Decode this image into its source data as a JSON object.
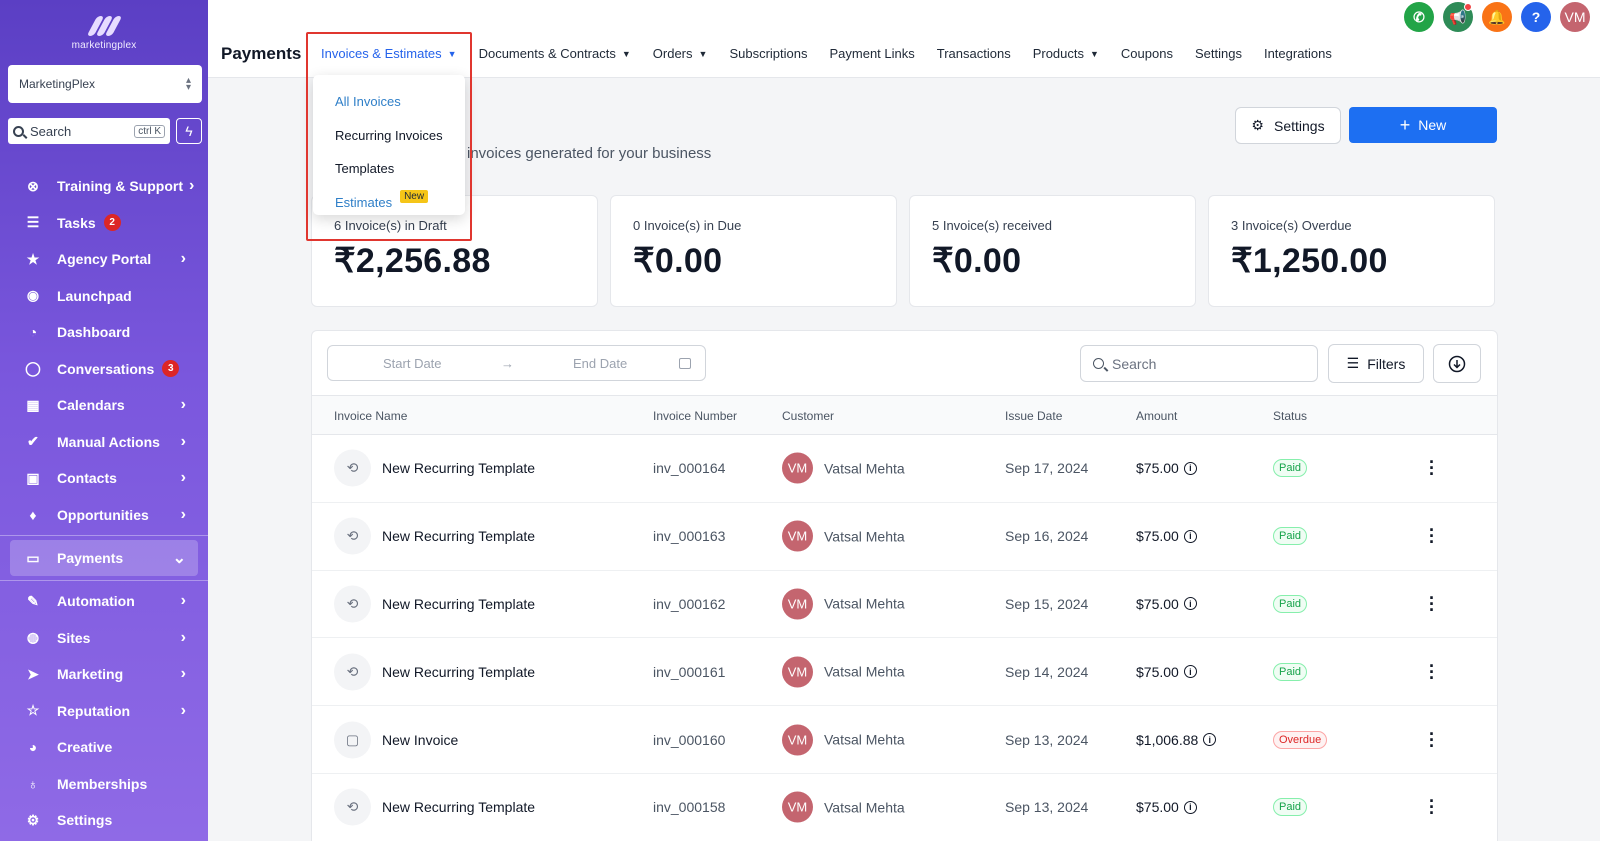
{
  "sidebar": {
    "logo_text": "marketingplex",
    "account": "MarketingPlex",
    "search_placeholder": "Search",
    "search_shortcut": "ctrl K",
    "items": [
      {
        "label": "Training & Support",
        "icon": "support-icon",
        "badge": "",
        "arrow": true
      },
      {
        "label": "Tasks",
        "icon": "tasks-icon",
        "badge": "2",
        "arrow": false
      },
      {
        "label": "Agency Portal",
        "icon": "star-icon",
        "badge": "",
        "arrow": true
      },
      {
        "label": "Launchpad",
        "icon": "launchpad-icon",
        "badge": "",
        "arrow": false
      },
      {
        "label": "Dashboard",
        "icon": "dashboard-icon",
        "badge": "",
        "arrow": false
      },
      {
        "label": "Conversations",
        "icon": "chat-icon",
        "badge": "3",
        "arrow": false
      },
      {
        "label": "Calendars",
        "icon": "calendar-icon",
        "badge": "",
        "arrow": true
      },
      {
        "label": "Manual Actions",
        "icon": "check-circle-icon",
        "badge": "",
        "arrow": true
      },
      {
        "label": "Contacts",
        "icon": "contacts-icon",
        "badge": "",
        "arrow": true
      },
      {
        "label": "Opportunities",
        "icon": "opportunities-icon",
        "badge": "",
        "arrow": true
      },
      {
        "label": "Payments",
        "icon": "payments-icon",
        "badge": "",
        "arrow": true,
        "active": true
      },
      {
        "label": "Automation",
        "icon": "automation-icon",
        "badge": "",
        "arrow": true
      },
      {
        "label": "Sites",
        "icon": "globe-icon",
        "badge": "",
        "arrow": true
      },
      {
        "label": "Marketing",
        "icon": "send-icon",
        "badge": "",
        "arrow": true
      },
      {
        "label": "Reputation",
        "icon": "star-outline-icon",
        "badge": "",
        "arrow": true
      },
      {
        "label": "Creative",
        "icon": "palette-icon",
        "badge": "",
        "arrow": false
      },
      {
        "label": "Memberships",
        "icon": "award-icon",
        "badge": "",
        "arrow": false
      },
      {
        "label": "Settings",
        "icon": "gear-icon",
        "badge": "",
        "arrow": false
      }
    ]
  },
  "topbar": {
    "title": "Payments",
    "tabs": [
      {
        "label": "Invoices & Estimates",
        "dropdown": true,
        "active": true
      },
      {
        "label": "Documents & Contracts",
        "dropdown": true
      },
      {
        "label": "Orders",
        "dropdown": true
      },
      {
        "label": "Subscriptions",
        "dropdown": false
      },
      {
        "label": "Payment Links",
        "dropdown": false
      },
      {
        "label": "Transactions",
        "dropdown": false
      },
      {
        "label": "Products",
        "dropdown": true
      },
      {
        "label": "Coupons",
        "dropdown": false
      },
      {
        "label": "Settings",
        "dropdown": false
      },
      {
        "label": "Integrations",
        "dropdown": false
      }
    ],
    "avatar_initials": "VM"
  },
  "dropdown": {
    "items": [
      {
        "label": "All Invoices",
        "selected": true
      },
      {
        "label": "Recurring Invoices",
        "selected": false
      },
      {
        "label": "Templates",
        "selected": false
      },
      {
        "label": "Estimates",
        "selected": true,
        "badge": "New"
      }
    ]
  },
  "main": {
    "subtitle": "invoices generated for your business",
    "settings_label": "Settings",
    "new_label": "New",
    "cards": [
      {
        "label": "6 Invoice(s) in Draft",
        "value": "₹2,256.88"
      },
      {
        "label": "0 Invoice(s) in Due",
        "value": "₹0.00"
      },
      {
        "label": "5 Invoice(s) received",
        "value": "₹0.00"
      },
      {
        "label": "3 Invoice(s) Overdue",
        "value": "₹1,250.00"
      }
    ],
    "start_date_placeholder": "Start Date",
    "end_date_placeholder": "End Date",
    "search_placeholder": "Search",
    "filters_label": "Filters",
    "columns": [
      "Invoice Name",
      "Invoice Number",
      "Customer",
      "Issue Date",
      "Amount",
      "Status"
    ],
    "rows": [
      {
        "name": "New Recurring Template",
        "number": "inv_000164",
        "initials": "VM",
        "customer": "Vatsal Mehta",
        "date": "Sep 17, 2024",
        "amount": "$75.00",
        "status": "Paid",
        "icon": "recurring-icon"
      },
      {
        "name": "New Recurring Template",
        "number": "inv_000163",
        "initials": "VM",
        "customer": "Vatsal Mehta",
        "date": "Sep 16, 2024",
        "amount": "$75.00",
        "status": "Paid",
        "icon": "recurring-icon"
      },
      {
        "name": "New Recurring Template",
        "number": "inv_000162",
        "initials": "VM",
        "customer": "Vatsal Mehta",
        "date": "Sep 15, 2024",
        "amount": "$75.00",
        "status": "Paid",
        "icon": "recurring-icon"
      },
      {
        "name": "New Recurring Template",
        "number": "inv_000161",
        "initials": "VM",
        "customer": "Vatsal Mehta",
        "date": "Sep 14, 2024",
        "amount": "$75.00",
        "status": "Paid",
        "icon": "recurring-icon"
      },
      {
        "name": "New Invoice",
        "number": "inv_000160",
        "initials": "VM",
        "customer": "Vatsal Mehta",
        "date": "Sep 13, 2024",
        "amount": "$1,006.88",
        "status": "Overdue",
        "icon": "document-icon"
      },
      {
        "name": "New Recurring Template",
        "number": "inv_000158",
        "initials": "VM",
        "customer": "Vatsal Mehta",
        "date": "Sep 13, 2024",
        "amount": "$75.00",
        "status": "Paid",
        "icon": "recurring-icon"
      }
    ]
  },
  "colors": {
    "accent": "#1d6ff2",
    "sidebar_top": "#5b3fc4",
    "sidebar_bottom": "#8f6ae6",
    "highlight": "#e0362f"
  }
}
